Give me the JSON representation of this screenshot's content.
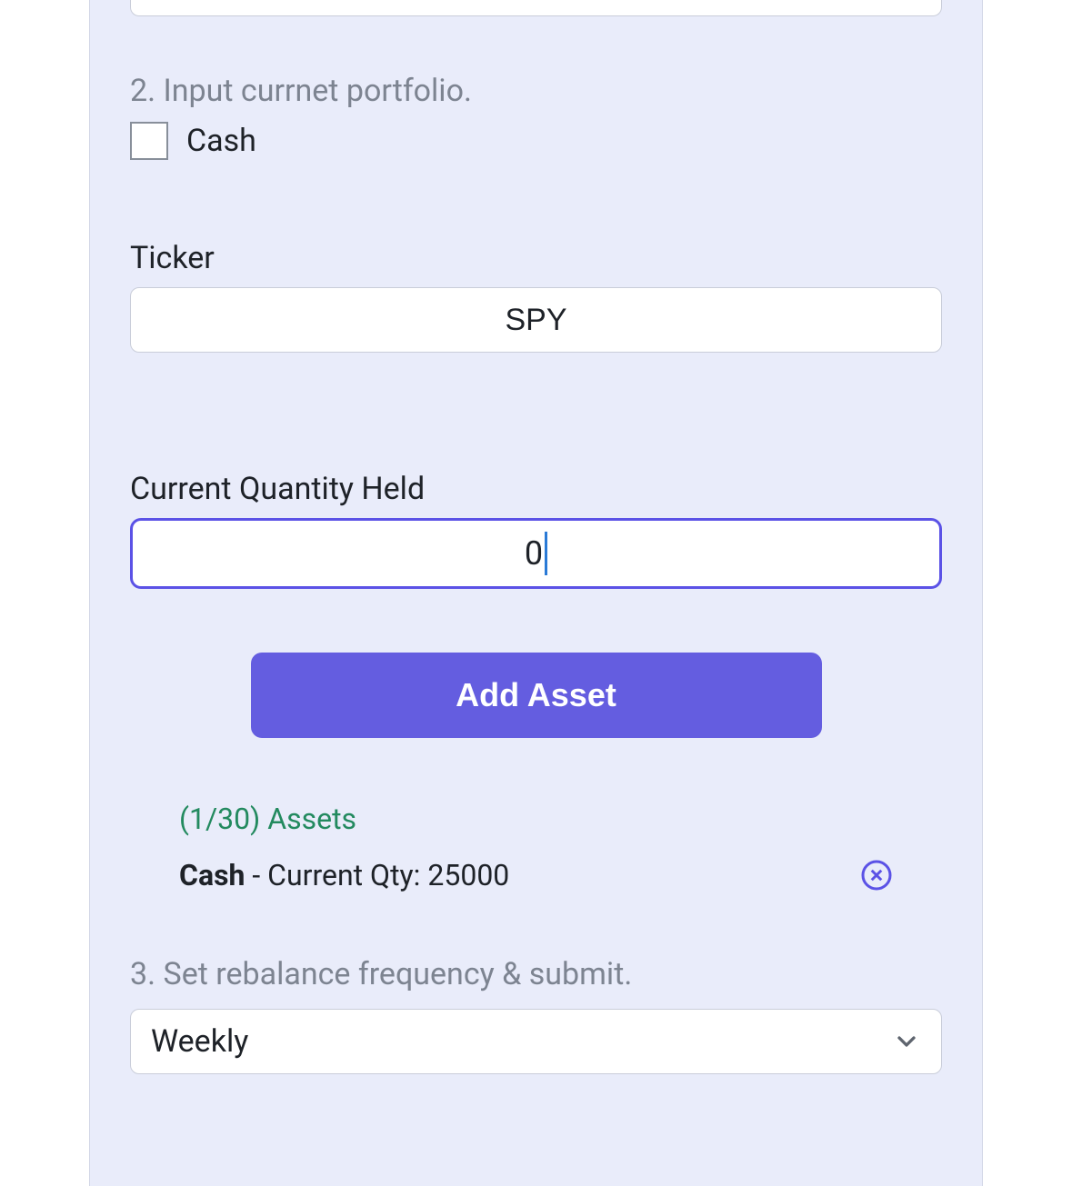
{
  "step2": {
    "heading": "2. Input currnet portfolio.",
    "cash_checkbox_label": "Cash",
    "cash_checked": false,
    "ticker_label": "Ticker",
    "ticker_value": "SPY",
    "qty_label": "Current Quantity Held",
    "qty_value": "0",
    "add_button_label": "Add Asset"
  },
  "assets": {
    "count_label": "(1/30) Assets",
    "items": [
      {
        "name": "Cash",
        "qty_label": " - Current Qty: ",
        "qty": "25000"
      }
    ]
  },
  "step3": {
    "heading": "3. Set rebalance frequency & submit.",
    "frequency_selected": "Weekly"
  }
}
